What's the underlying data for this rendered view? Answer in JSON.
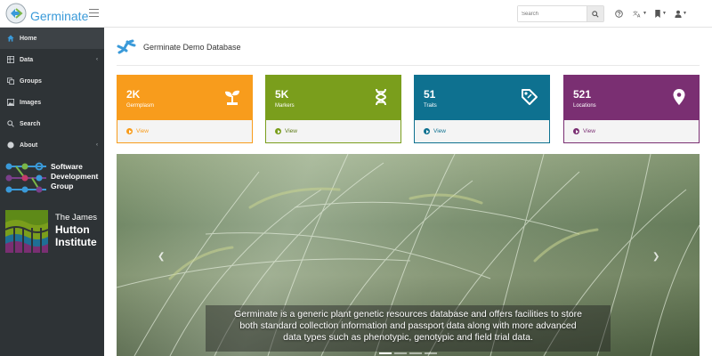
{
  "app": {
    "brand": "Germinate"
  },
  "search": {
    "placeholder": "Search"
  },
  "sidebar": {
    "items": [
      {
        "label": "Home",
        "icon": "home-icon",
        "active": true
      },
      {
        "label": "Data",
        "icon": "data-icon",
        "has_children": true
      },
      {
        "label": "Groups",
        "icon": "groups-icon"
      },
      {
        "label": "Images",
        "icon": "images-icon"
      },
      {
        "label": "Search",
        "icon": "search-icon"
      },
      {
        "label": "About",
        "icon": "about-icon",
        "has_children": true
      }
    ],
    "sdg_logo": {
      "line1": "Software",
      "line2": "Development",
      "line3": "Group"
    },
    "hutton_logo": {
      "line1": "The James",
      "line2": "Hutton",
      "line3": "Institute"
    }
  },
  "page": {
    "title": "Germinate Demo Database"
  },
  "cards": [
    {
      "value": "2K",
      "label": "Germplasm",
      "view": "View",
      "color": "#f89c1c",
      "icon": "plant-icon"
    },
    {
      "value": "5K",
      "label": "Markers",
      "view": "View",
      "color": "#7a9e1c",
      "icon": "dna-icon"
    },
    {
      "value": "51",
      "label": "Traits",
      "view": "View",
      "color": "#0e7190",
      "icon": "tag-icon"
    },
    {
      "value": "521",
      "label": "Locations",
      "view": "View",
      "color": "#7a2f72",
      "icon": "map-marker-icon"
    }
  ],
  "carousel": {
    "caption_line1": "Germinate is a generic plant genetic resources database and offers facilities to store",
    "caption_line2": "both standard collection information and passport data along with more advanced",
    "caption_line3": "data types such as phenotypic, genotypic and field trial data.",
    "slides": 4,
    "active_slide": 1
  }
}
